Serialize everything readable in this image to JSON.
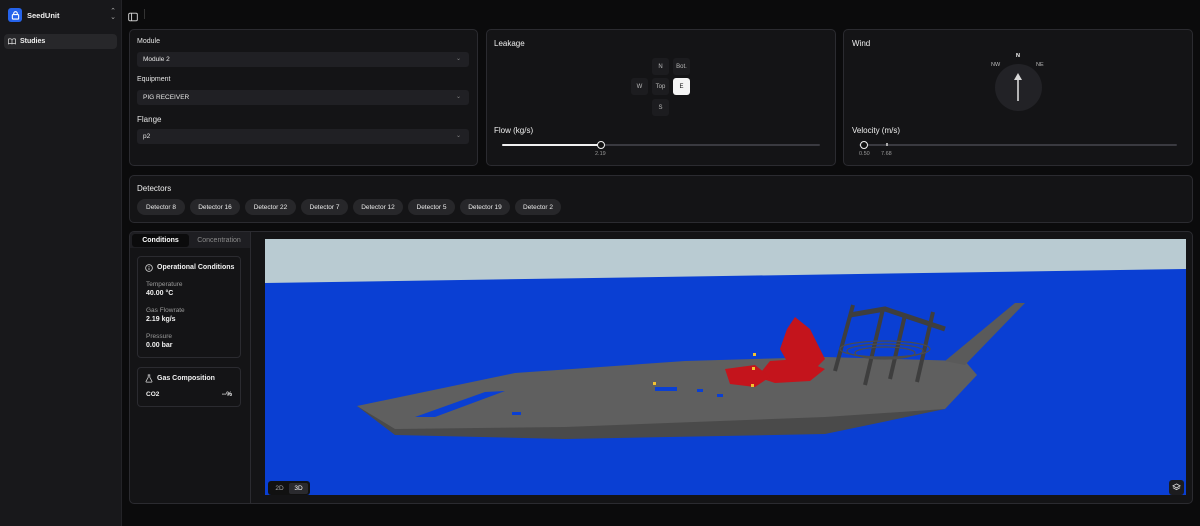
{
  "app": {
    "name": "SeedUnit"
  },
  "sidebar": {
    "items": [
      {
        "label": "Studies"
      }
    ]
  },
  "source": {
    "module": {
      "label": "Module",
      "value": "Module 2"
    },
    "equipment": {
      "label": "Equipment",
      "value": "PIG RECEIVER"
    },
    "flange": {
      "label": "Flange",
      "value": "p2"
    }
  },
  "leakage": {
    "title": "Leakage",
    "directions": [
      "N",
      "Bot.",
      "W",
      "Top",
      "E",
      "S"
    ],
    "selected_direction": "E",
    "flow_label": "Flow (kg/s)",
    "flow_value": "2.19",
    "flow_fraction": 0.31
  },
  "wind": {
    "title": "Wind",
    "compass": {
      "n": "N",
      "nw": "NW",
      "ne": "NE"
    },
    "velocity_label": "Velocity (m/s)",
    "velocity_min": "0.50",
    "velocity_value": "7.68",
    "velocity_fraction": 0.0
  },
  "detectors": {
    "title": "Detectors",
    "items": [
      "Detector 8",
      "Detector 16",
      "Detector 22",
      "Detector 7",
      "Detector 12",
      "Detector 5",
      "Detector 19",
      "Detector 2"
    ]
  },
  "tabs": {
    "conditions": "Conditions",
    "concentration": "Concentration",
    "active": "Conditions"
  },
  "operational": {
    "title": "Operational Conditions",
    "temperature_label": "Temperature",
    "temperature_value": "40.00 °C",
    "flowrate_label": "Gas Flowrate",
    "flowrate_value": "2.19 kg/s",
    "pressure_label": "Pressure",
    "pressure_value": "0.00 bar"
  },
  "composition": {
    "title": "Gas Composition",
    "component": "CO2",
    "value": "--%"
  },
  "view": {
    "mode_2d": "2D",
    "mode_3d": "3D",
    "active": "3D"
  },
  "colors": {
    "accent": "#2563eb",
    "sea": "#0a3fd3",
    "sky": "#b9cbd2",
    "hull": "#5f5f5f",
    "plume": "#c4141c"
  }
}
